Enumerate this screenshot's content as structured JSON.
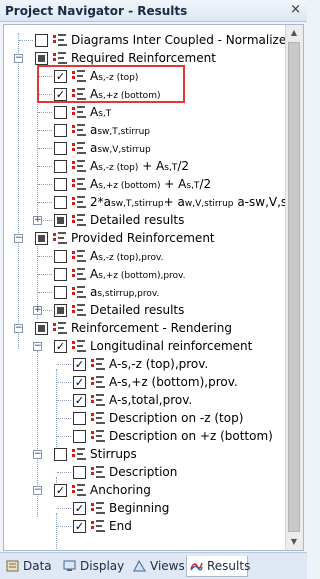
{
  "window": {
    "title": "Project Navigator - Results",
    "close_glyph": "×"
  },
  "tree": {
    "diagrams_inter_coupled": "Diagrams Inter Coupled - Normalized",
    "required_reinforcement": {
      "label": "Required Reinforcement",
      "items": [
        {
          "main": "A",
          "sub": "s,-z (top)",
          "rest": "",
          "checked": true
        },
        {
          "main": "A",
          "sub": "s,+z (bottom)",
          "rest": "",
          "checked": true
        },
        {
          "main": "A",
          "sub": "s,T",
          "rest": "",
          "checked": false
        },
        {
          "main": "a",
          "sub": "sw,T,stirrup",
          "rest": "",
          "checked": false
        },
        {
          "main": "a",
          "sub": "sw,V,stirrup",
          "rest": "",
          "checked": false
        },
        {
          "main": "A",
          "sub": "s,-z (top)",
          "rest": " + A",
          "sub2": "s,T",
          "rest2": "/2",
          "checked": false
        },
        {
          "main": "A",
          "sub": "s,+z (bottom)",
          "rest": " + A",
          "sub2": "s,T",
          "rest2": "/2",
          "checked": false
        },
        {
          "main": "2*a",
          "sub": "sw,T,stirrup",
          "rest": "+ a",
          "sub2": "w,V,stirrup",
          "rest2": " a-sw,V,stirrup",
          "checked": false
        }
      ],
      "detailed": "Detailed results"
    },
    "provided_reinforcement": {
      "label": "Provided Reinforcement",
      "items": [
        {
          "main": "A",
          "sub": "s,-z (top),prov.",
          "checked": false
        },
        {
          "main": "A",
          "sub": "s,+z (bottom),prov.",
          "checked": false
        },
        {
          "main": "a",
          "sub": "s,stirrup,prov.",
          "checked": false
        }
      ],
      "detailed": "Detailed results"
    },
    "rendering": {
      "label": "Reinforcement - Rendering",
      "longitudinal": {
        "label": "Longitudinal reinforcement",
        "items": [
          {
            "label": "A-s,-z (top),prov.",
            "checked": true
          },
          {
            "label": "A-s,+z (bottom),prov.",
            "checked": true
          },
          {
            "label": "A-s,total,prov.",
            "checked": true
          },
          {
            "label": "Description on -z (top)",
            "checked": false
          },
          {
            "label": "Description on +z (bottom)",
            "checked": false
          }
        ]
      },
      "stirrups": {
        "label": "Stirrups",
        "description": "Description"
      },
      "anchoring": {
        "label": "Anchoring",
        "beginning": "Beginning",
        "end": "End"
      }
    }
  },
  "tabs": [
    {
      "label": "Data",
      "icon": "data-icon"
    },
    {
      "label": "Display",
      "icon": "display-icon"
    },
    {
      "label": "Views",
      "icon": "views-icon"
    },
    {
      "label": "Results",
      "icon": "results-icon",
      "active": true
    }
  ]
}
